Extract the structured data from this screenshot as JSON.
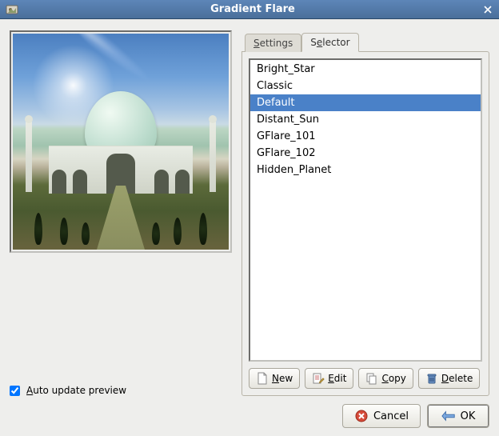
{
  "window": {
    "title": "Gradient Flare"
  },
  "tabs": {
    "settings": "Settings",
    "selector": "Selector",
    "active": "selector"
  },
  "flares": {
    "items": [
      "Bright_Star",
      "Classic",
      "Default",
      "Distant_Sun",
      "GFlare_101",
      "GFlare_102",
      "Hidden_Planet"
    ],
    "selected_index": 2
  },
  "buttons": {
    "new": "New",
    "edit": "Edit",
    "copy": "Copy",
    "delete": "Delete",
    "cancel": "Cancel",
    "ok": "OK"
  },
  "checkbox": {
    "auto_update": "Auto update preview",
    "checked": true
  }
}
